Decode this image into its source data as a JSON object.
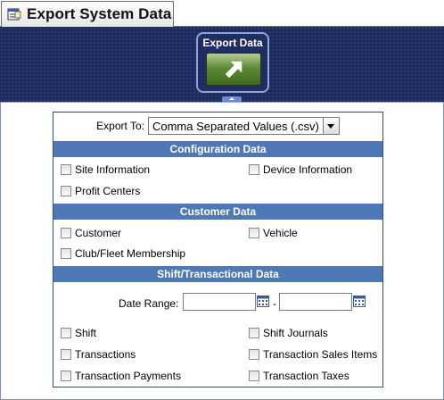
{
  "window": {
    "title": "Export System Data",
    "icon": "form-icon"
  },
  "toolbar": {
    "export_label": "Export Data",
    "export_icon": "arrow-up-right-icon"
  },
  "export_to": {
    "label": "Export To:",
    "selected": "Comma Separated Values (.csv)"
  },
  "sections": {
    "configuration": {
      "title": "Configuration Data",
      "items": [
        "Site Information",
        "Device Information",
        "Profit Centers"
      ]
    },
    "customer": {
      "title": "Customer Data",
      "items": [
        "Customer",
        "Vehicle",
        "Club/Fleet Membership"
      ]
    },
    "shift": {
      "title": "Shift/Transactional Data",
      "date_range_label": "Date Range:",
      "date_separator": "-",
      "date_from": "",
      "date_to": "",
      "items": [
        "Shift",
        "Shift Journals",
        "Transactions",
        "Transaction Sales Items",
        "Transaction Payments",
        "Transaction Taxes"
      ]
    }
  },
  "colors": {
    "toolbar_bg": "#1f2a5c",
    "section_header": "#4e79b6",
    "button_green": "#5f8a37"
  }
}
